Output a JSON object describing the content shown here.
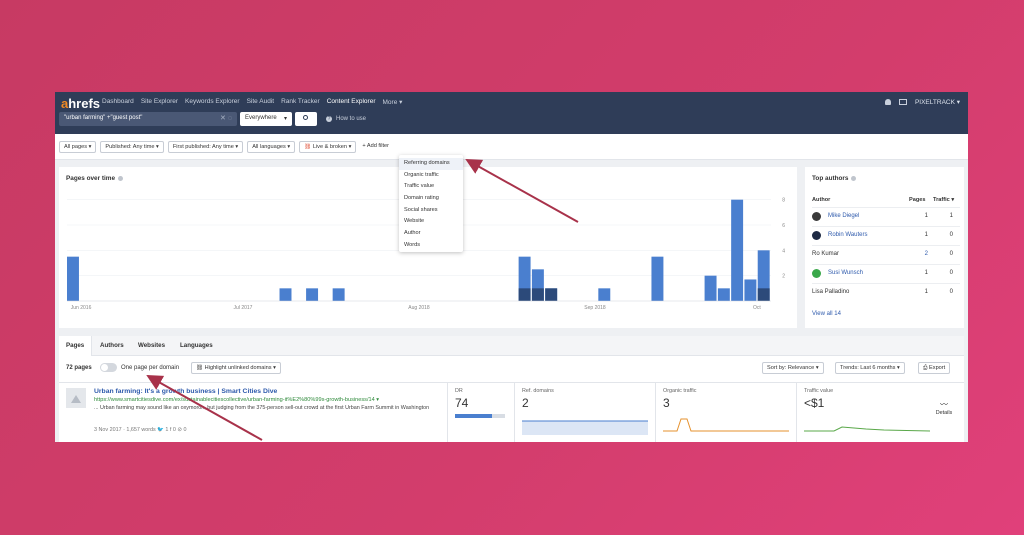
{
  "header": {
    "logo_a": "a",
    "logo_rest": "hrefs",
    "nav": [
      "Dashboard",
      "Site Explorer",
      "Keywords Explorer",
      "Site Audit",
      "Rank Tracker",
      "Content Explorer",
      "More ▾"
    ],
    "account": "PIXELTRACK ▾",
    "search_value": "\"urban farming\" +\"guest post\"",
    "search_mode": "Everywhere",
    "search_mode_caret": "▾",
    "how_to": "How to use"
  },
  "filters": {
    "all_pages": "All pages ▾",
    "published": "Published: Any time ▾",
    "first_published": "First published: Any time ▾",
    "all_languages": "All languages ▾",
    "live_broken": "Live & broken ▾",
    "add_filter": "+  Add filter"
  },
  "filter_menu": [
    "Referring domains",
    "Organic traffic",
    "Traffic value",
    "Domain rating",
    "Social shares",
    "Website",
    "Author",
    "Words"
  ],
  "chart": {
    "title": "Pages over time"
  },
  "chart_data": {
    "type": "bar",
    "title": "Pages over time",
    "x_tick_labels": [
      "Jun 2016",
      "Jul 2017",
      "Aug 2018",
      "Sep 2018",
      "Oct"
    ],
    "y_ticks": [
      2,
      4,
      6,
      8
    ],
    "ylim": [
      0,
      9
    ],
    "bar_count": 53,
    "series": [
      {
        "color": "#4a7fcf",
        "values": [
          3.5,
          0,
          0,
          0,
          0,
          0,
          0,
          0,
          0,
          0,
          0,
          0,
          0,
          0,
          0,
          0,
          1,
          0,
          1,
          0,
          1,
          0,
          0,
          0,
          0,
          0,
          0,
          0,
          0,
          0,
          0,
          0,
          0,
          0,
          3.5,
          2.5,
          1,
          0,
          0,
          0,
          1,
          0,
          0,
          0,
          3.5,
          0,
          0,
          0,
          2,
          1,
          8,
          1.7,
          4,
          4.3
        ]
      },
      {
        "color": "#2c4a7a",
        "values": [
          0,
          0,
          0,
          0,
          0,
          0,
          0,
          0,
          0,
          0,
          0,
          0,
          0,
          0,
          0,
          0,
          0,
          0,
          0,
          0,
          0,
          0,
          0,
          0,
          0,
          0,
          0,
          0,
          0,
          0,
          0,
          0,
          0,
          0,
          1,
          1,
          1,
          0,
          0,
          0,
          0,
          0,
          0,
          0,
          0,
          0,
          0,
          0,
          0,
          0,
          0,
          0,
          1,
          1,
          1
        ]
      }
    ]
  },
  "top_authors": {
    "title": "Top authors",
    "col_author": "Author",
    "col_pages": "Pages",
    "col_traffic": "Traffic ▾",
    "rows": [
      {
        "name": "Mike Diegel",
        "pages": "1",
        "traffic": "1",
        "avatar_color": "#3a3a3a",
        "link": true
      },
      {
        "name": "Robin Wauters",
        "pages": "1",
        "traffic": "0",
        "avatar_color": "#1e2a44",
        "link": true
      },
      {
        "name": "Ro Kumar",
        "pages": "2",
        "traffic": "0",
        "avatar_color": "",
        "link": false
      },
      {
        "name": "Susi Wunsch",
        "pages": "1",
        "traffic": "0",
        "avatar_color": "#3aa84a",
        "link": true
      },
      {
        "name": "Lisa Palladino",
        "pages": "1",
        "traffic": "0",
        "avatar_color": "",
        "link": false
      }
    ],
    "view_all": "View all 14"
  },
  "tabs": [
    "Pages",
    "Authors",
    "Websites",
    "Languages"
  ],
  "results_bar": {
    "count": "72 pages",
    "one_per_domain": "One page per domain",
    "highlight": "Highlight unlinked domains ▾",
    "sort": "Sort by: Relevance ▾",
    "trends": "Trends: Last 6 months ▾",
    "export": "Export"
  },
  "result": {
    "title": "Urban farming: It's a growth business | Smart Cities Dive",
    "url": "https://www.smartcitiesdive.com/ex/sustainablecitiescollective/urban-farming-it%E2%80%99s-growth-business/14 ▾",
    "description": "... Urban farming may sound like an oxymoron, but judging from the 375-person sell-out crowd at the first Urban Farm Summit in Washington",
    "meta": "3 Nov 2017 · 1,657 words   🐦 1   f 0   ⊘ 0",
    "dr_label": "DR",
    "dr_value": "74",
    "dr_fraction": 0.74,
    "ref_label": "Ref. domains",
    "ref_value": "2",
    "organic_label": "Organic traffic",
    "organic_value": "3",
    "tv_label": "Traffic value",
    "tv_value": "<$1",
    "details": "Details"
  },
  "colors": {
    "background": "#d23d6b",
    "header": "#2f3d58",
    "bar": "#4a7fcf",
    "bar_dark": "#2c4a7a",
    "arrow": "#a8324a",
    "organic_line": "#e6912e",
    "value_line": "#5aa84a"
  }
}
